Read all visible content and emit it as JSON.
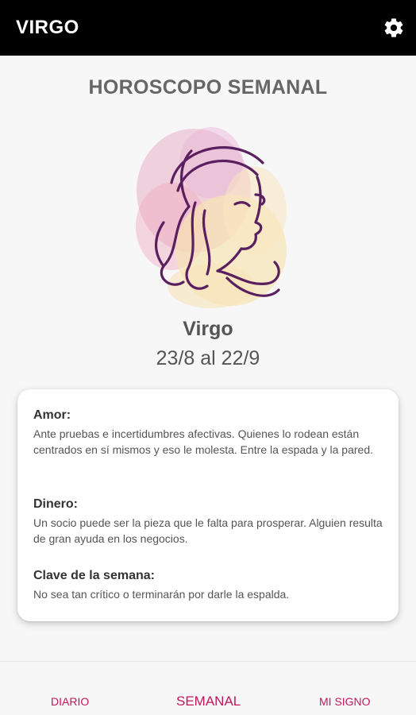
{
  "appbar": {
    "title": "VIRGO",
    "settings_icon": "gear-icon"
  },
  "main": {
    "heading": "HOROSCOPO SEMANAL",
    "sign_name": "Virgo",
    "sign_dates": "23/8 al 22/9",
    "illustration_icon": "virgo-woman-illustration"
  },
  "card": {
    "sections": [
      {
        "title": "Amor:",
        "text": "Ante pruebas e incertidumbres afectivas. Quienes lo rodean están centrados en sí mismos y eso le molesta. Entre la espada y la pared."
      },
      {
        "title": "Dinero:",
        "text": "Un socio puede ser la pieza que le falta para prosperar. Alguien resulta de gran ayuda en los negocios."
      },
      {
        "title": "Clave de la semana:",
        "text": "No sea tan crítico o terminarán por darle la espalda."
      }
    ]
  },
  "bottom_nav": {
    "items": [
      {
        "label": "DIARIO"
      },
      {
        "label": "SEMANAL"
      },
      {
        "label": "MI SIGNO"
      }
    ],
    "accent_color": "#c2185b"
  },
  "colors": {
    "appbar_bg": "#000000",
    "background": "#f7f7f7",
    "illustration_line": "#5a1f5e"
  }
}
